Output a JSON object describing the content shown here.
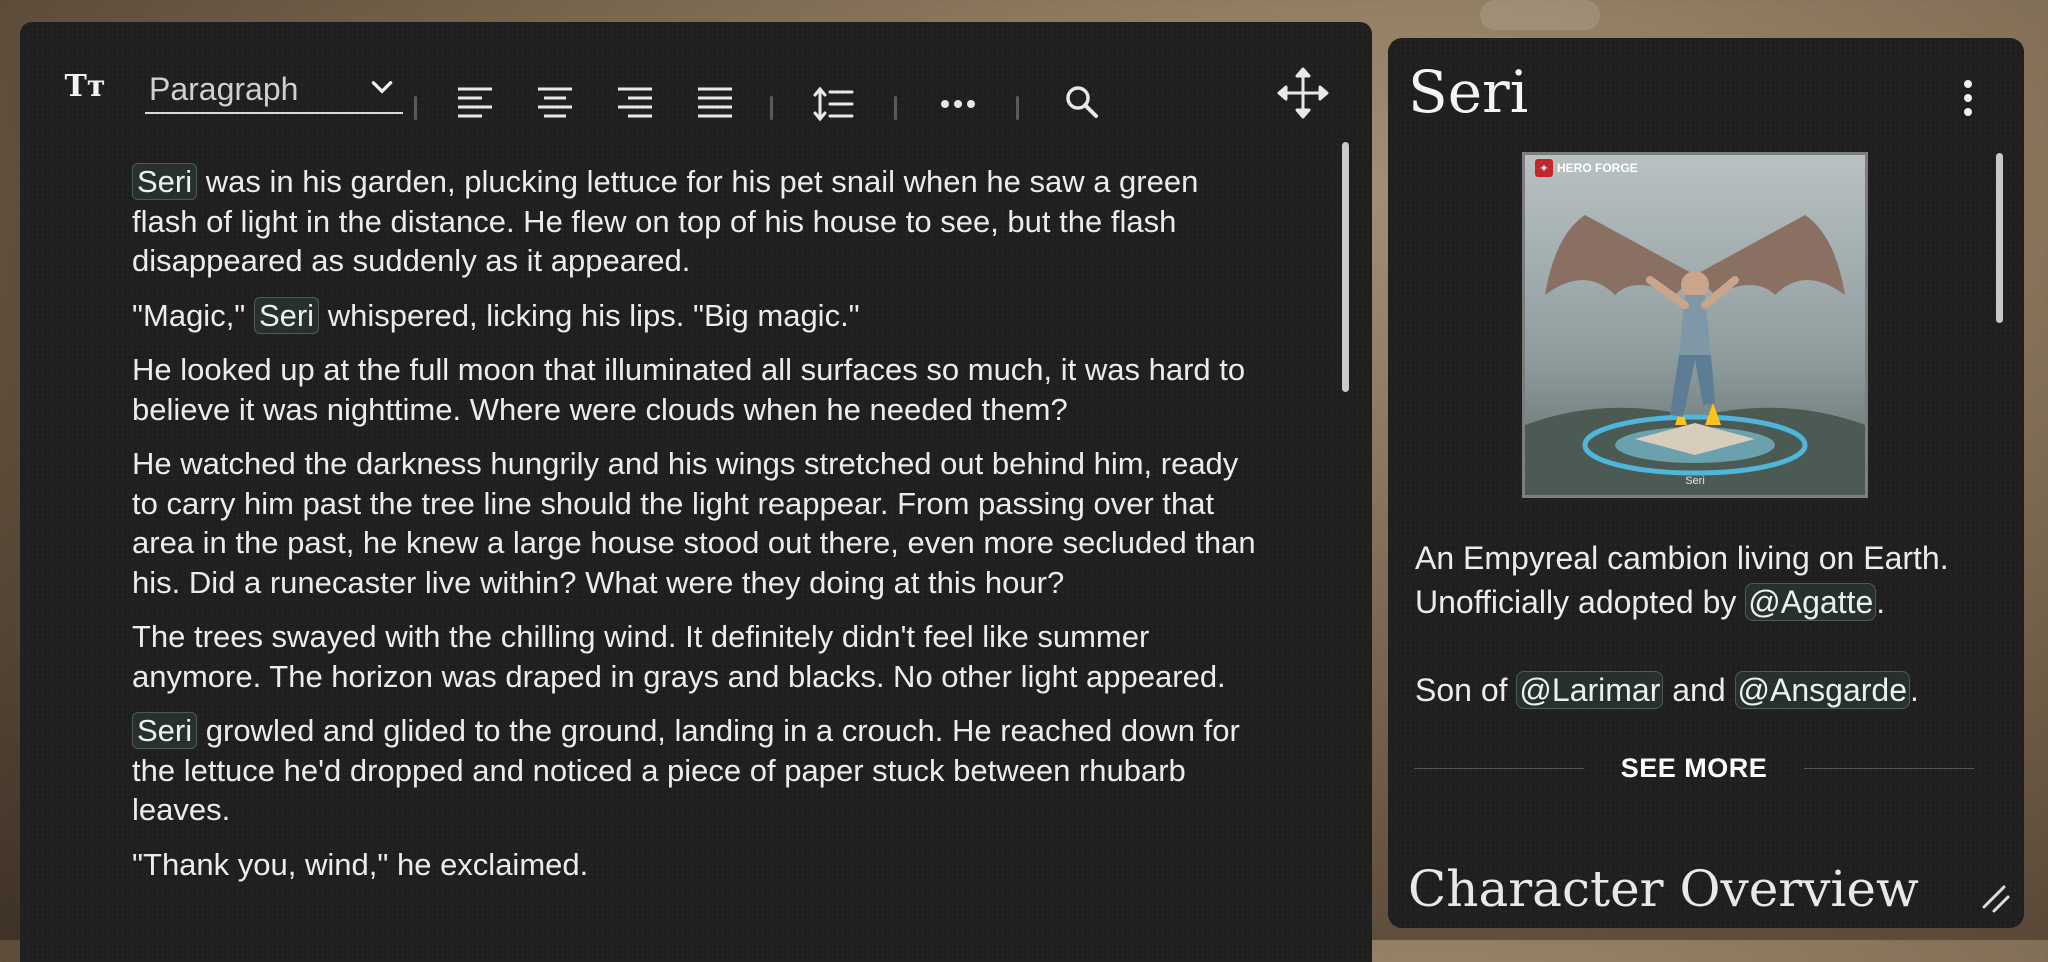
{
  "editor": {
    "toolbar": {
      "text_style_icon": "text-size-icon",
      "paragraph_style": "Paragraph",
      "icons": [
        "align-left-icon",
        "align-center-icon",
        "align-right-icon",
        "align-justify-icon",
        "line-height-icon",
        "more-options-icon",
        "search-icon",
        "move-icon"
      ]
    },
    "paragraphs": [
      {
        "mention": "Seri",
        "text": " was in his garden, plucking lettuce for his pet snail when he saw a green flash of light in the distance. He flew on top of his house to see, but the flash disappeared as suddenly as it appeared."
      },
      {
        "before": "\"Magic,\" ",
        "mention": "Seri",
        "after": " whispered, licking his lips. \"Big magic.\""
      },
      {
        "text": "He looked up at the full moon that illuminated all surfaces so much, it was hard to believe it was nighttime. Where were clouds when he needed them?"
      },
      {
        "text": "He watched the darkness hungrily and his wings stretched out behind him, ready to carry him past the tree line should the light reappear. From passing over that area in the past, he knew a large house stood out there, even more secluded than his. Did a runecaster live within? What were they doing at this hour?"
      },
      {
        "text": "The trees swayed with the chilling wind. It definitely didn't feel like summer anymore. The horizon was draped in grays and blacks. No other light appeared."
      },
      {
        "mention": "Seri",
        "text": " growled and glided to the ground, landing in a crouch. He reached down for the lettuce he'd dropped and noticed a piece of paper stuck between rhubarb leaves."
      },
      {
        "text": "\"Thank you, wind,\" he exclaimed."
      }
    ]
  },
  "side_panel": {
    "title": "Seri",
    "menu_icon": "kebab-menu-icon",
    "portrait": {
      "brand": "HERO FORGE",
      "caption": "Seri",
      "colors": {
        "sky": "#9aa6a8",
        "wings": "#8a6f63",
        "glow": "#4fb6d9",
        "fire": "#ffc21a"
      }
    },
    "bio": {
      "line1": "An Empyreal cambion living on Earth.",
      "line2_prefix": "Unofficially adopted by ",
      "mention_agatte": "@Agatte",
      "line2_suffix": ".",
      "line3_prefix": "Son of ",
      "mention_larimar": "@Larimar",
      "line3_mid": " and ",
      "mention_ansgarde": "@Ansgarde",
      "line3_suffix": "."
    },
    "see_more": "SEE MORE",
    "section_heading": "Character Overview",
    "resize_icon": "resize-handle-icon"
  },
  "colors": {
    "panel_bg": "#1f1f1f",
    "mention_border": "#4c5b57",
    "text": "#ececec"
  }
}
